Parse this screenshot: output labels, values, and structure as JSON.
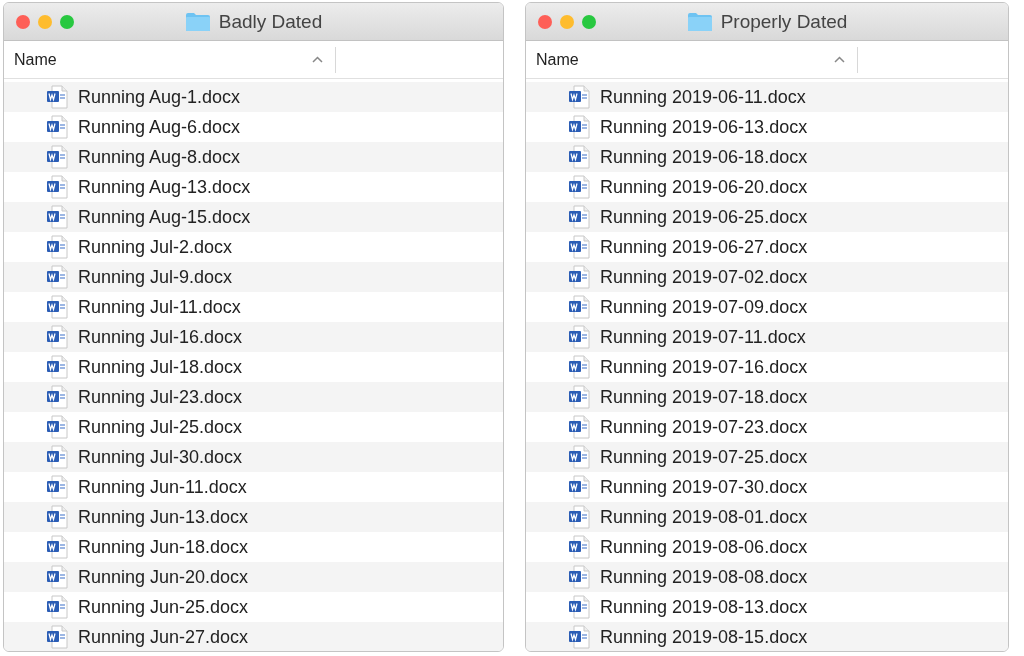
{
  "windows": [
    {
      "title": "Badly Dated",
      "column": "Name",
      "files": [
        "Running Aug-1.docx",
        "Running Aug-6.docx",
        "Running Aug-8.docx",
        "Running Aug-13.docx",
        "Running Aug-15.docx",
        "Running Jul-2.docx",
        "Running Jul-9.docx",
        "Running Jul-11.docx",
        "Running Jul-16.docx",
        "Running Jul-18.docx",
        "Running Jul-23.docx",
        "Running Jul-25.docx",
        "Running Jul-30.docx",
        "Running Jun-11.docx",
        "Running Jun-13.docx",
        "Running Jun-18.docx",
        "Running Jun-20.docx",
        "Running Jun-25.docx",
        "Running Jun-27.docx"
      ]
    },
    {
      "title": "Properly Dated",
      "column": "Name",
      "files": [
        "Running 2019-06-11.docx",
        "Running 2019-06-13.docx",
        "Running 2019-06-18.docx",
        "Running 2019-06-20.docx",
        "Running 2019-06-25.docx",
        "Running 2019-06-27.docx",
        "Running 2019-07-02.docx",
        "Running 2019-07-09.docx",
        "Running 2019-07-11.docx",
        "Running 2019-07-16.docx",
        "Running 2019-07-18.docx",
        "Running 2019-07-23.docx",
        "Running 2019-07-25.docx",
        "Running 2019-07-30.docx",
        "Running 2019-08-01.docx",
        "Running 2019-08-06.docx",
        "Running 2019-08-08.docx",
        "Running 2019-08-13.docx",
        "Running 2019-08-15.docx"
      ]
    }
  ]
}
